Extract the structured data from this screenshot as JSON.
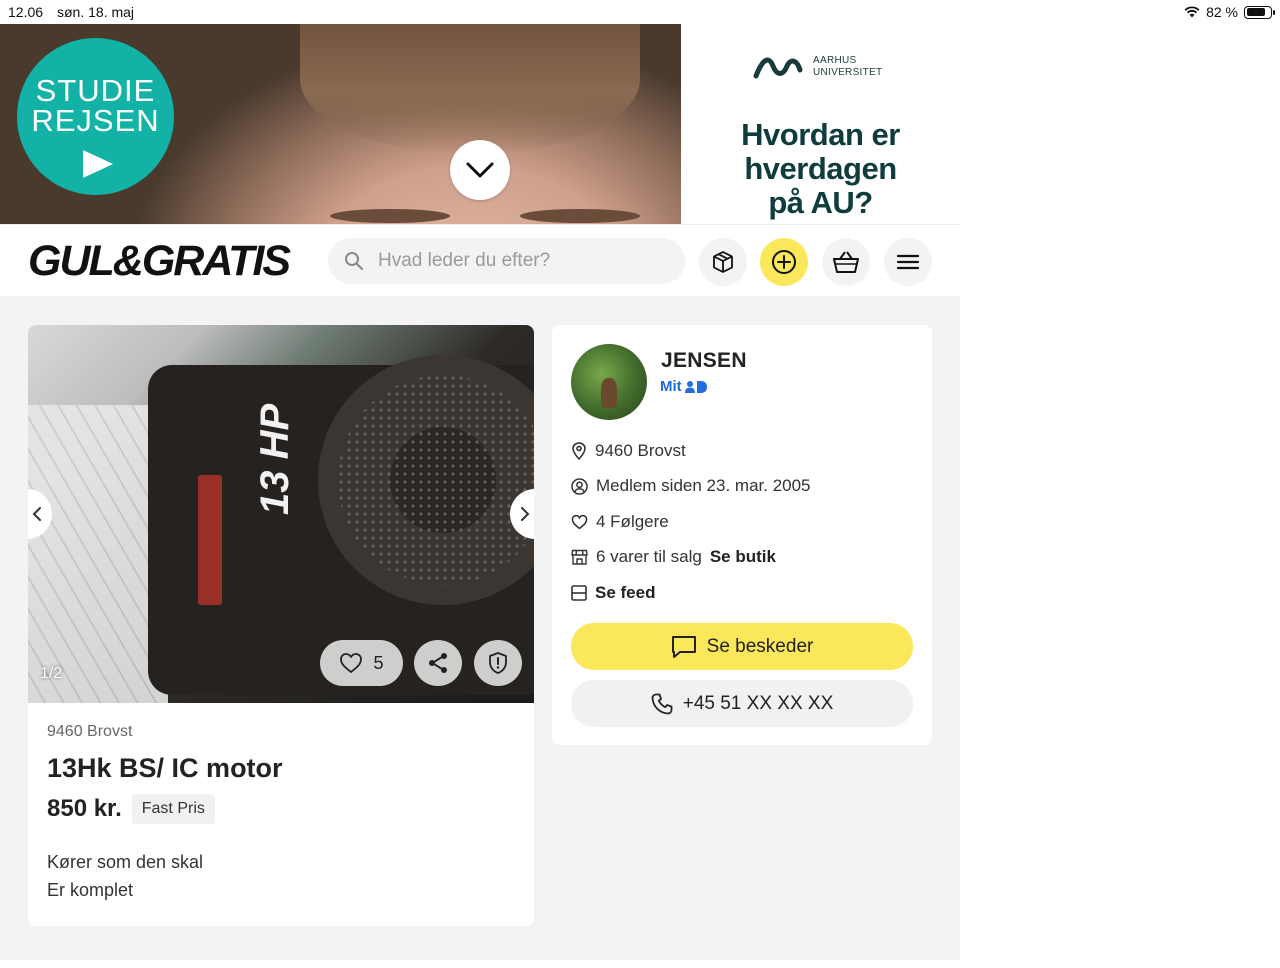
{
  "status_bar": {
    "time": "12.06",
    "date": "søn. 18. maj",
    "battery": "82 %",
    "battery_level": 0.82
  },
  "ad": {
    "studie_logo": "STUDIE REJSEN",
    "au_logo_line1": "AARHUS",
    "au_logo_line2": "UNIVERSITET",
    "headline": "Hvordan er hverdagen på AU?"
  },
  "header": {
    "logo": "GUL&GRATIS",
    "search_placeholder": "Hvad leder du efter?",
    "icons": [
      "package-icon",
      "add-icon",
      "basket-icon",
      "menu-icon"
    ]
  },
  "listing": {
    "photo_counter": "1/2",
    "photo_label": "13 HP",
    "likes": "5",
    "location": "9460 Brovst",
    "title": "13Hk BS/ IC motor",
    "price": "850 kr.",
    "price_type": "Fast Pris",
    "description": [
      "Kører som den skal",
      "Er komplet"
    ]
  },
  "seller": {
    "name": "JENSEN",
    "mitid": "Mit",
    "location": "9460 Brovst",
    "member_since": "Medlem siden 23. mar. 2005",
    "followers": "4 Følgere",
    "for_sale": "6 varer til salg",
    "shop_link": "Se butik",
    "feed_link": "Se feed",
    "message_button": "Se beskeder",
    "phone_button": "+45 51 XX XX XX"
  },
  "colors": {
    "brand_yellow": "#fbe75a",
    "mitid_blue": "#1f6fe0",
    "studie_teal": "#12b3a6",
    "au_green": "#0e3b3b"
  }
}
